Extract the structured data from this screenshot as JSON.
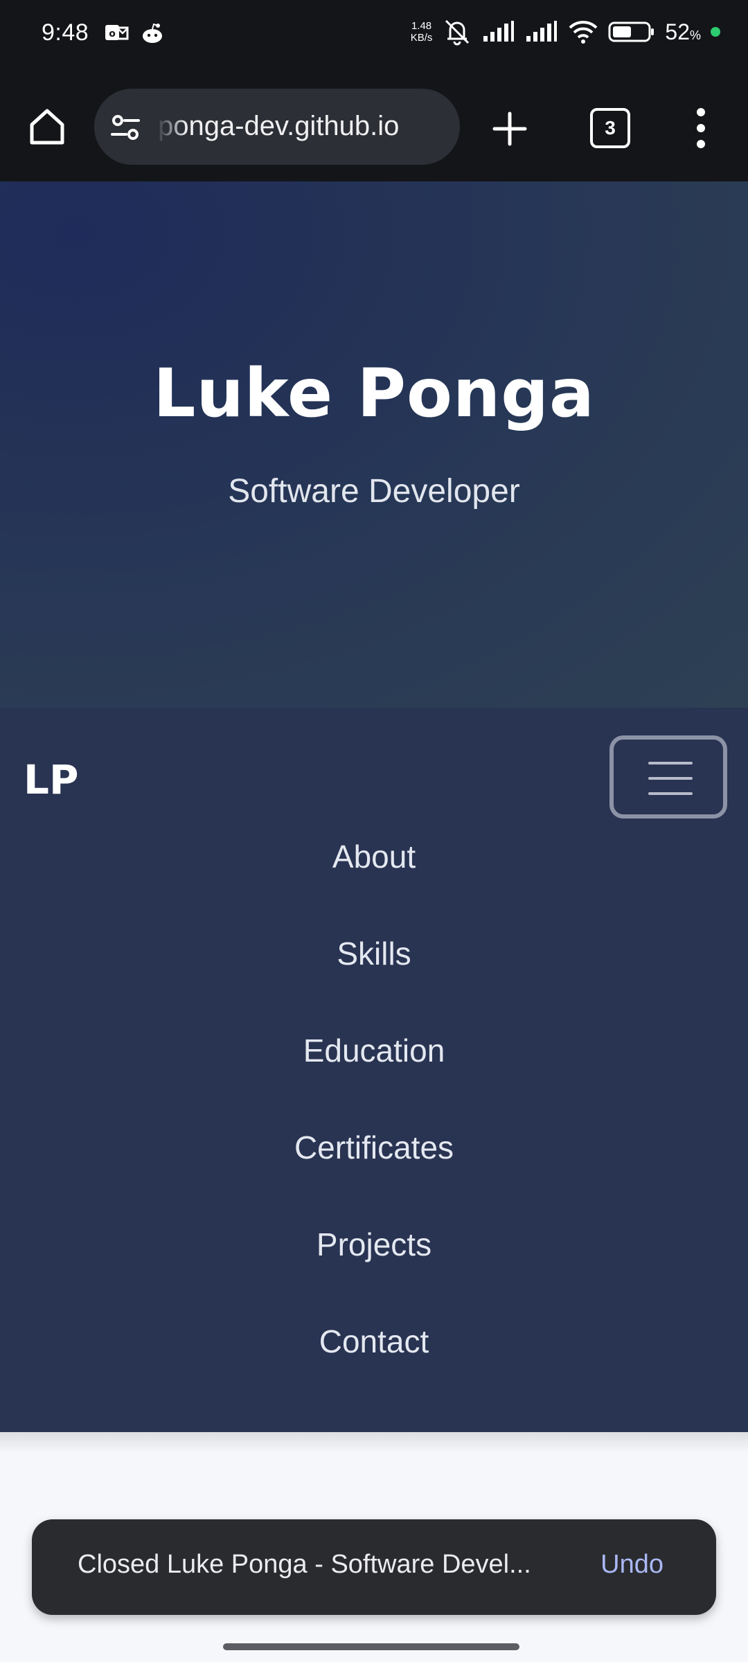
{
  "status_bar": {
    "time": "9:48",
    "net_speed_value": "1.48",
    "net_speed_unit": "KB/s",
    "battery_percent": "52",
    "battery_unit": "%"
  },
  "browser": {
    "url": "ponga-dev.github.io",
    "tab_count": "3"
  },
  "hero": {
    "name": "Luke Ponga",
    "subtitle": "Software Developer"
  },
  "nav": {
    "logo": "LP",
    "links": [
      "About",
      "Skills",
      "Education",
      "Certificates",
      "Projects",
      "Contact"
    ]
  },
  "snackbar": {
    "message": "Closed Luke Ponga - Software Devel...",
    "action": "Undo"
  },
  "colors": {
    "hero_start": "#1f2b5a",
    "hero_end": "#2d4054",
    "nav_bg": "#293352",
    "snackbar_bg": "#2a2b2f",
    "undo_accent": "#aab8f5",
    "battery_dot": "#2ecc71"
  }
}
